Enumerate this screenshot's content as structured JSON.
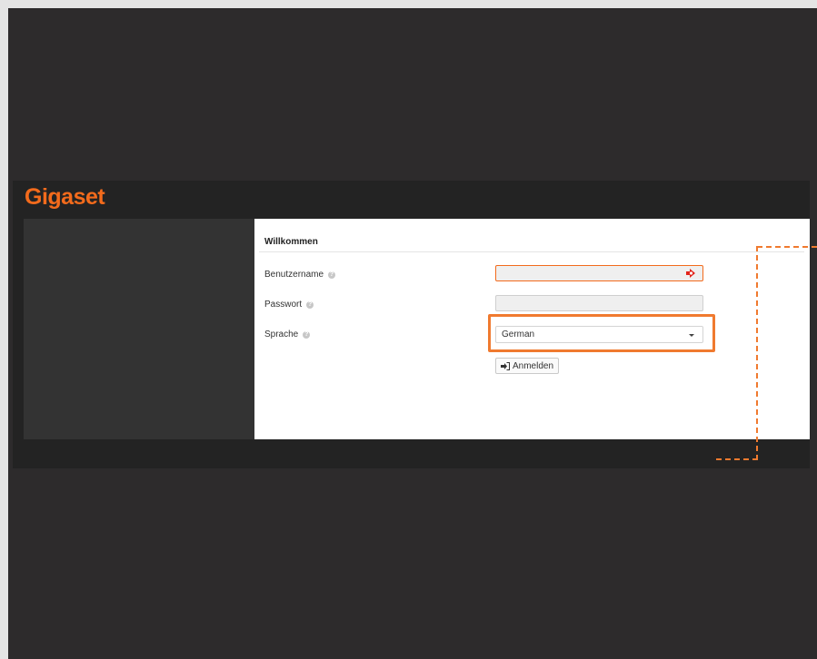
{
  "brand": {
    "logo_text": "Gigaset"
  },
  "login": {
    "title": "Willkommen",
    "username_label": "Benutzername",
    "password_label": "Passwort",
    "language_label": "Sprache",
    "language_value": "German",
    "submit_label": "Anmelden"
  },
  "colors": {
    "accent": "#f36b1c",
    "background": "#2d2b2c",
    "panel": "#ffffff"
  },
  "icons": {
    "help": "question-circle-icon",
    "username_field": "autofill-key-icon",
    "language_dropdown": "caret-down-icon",
    "submit": "sign-in-icon"
  }
}
